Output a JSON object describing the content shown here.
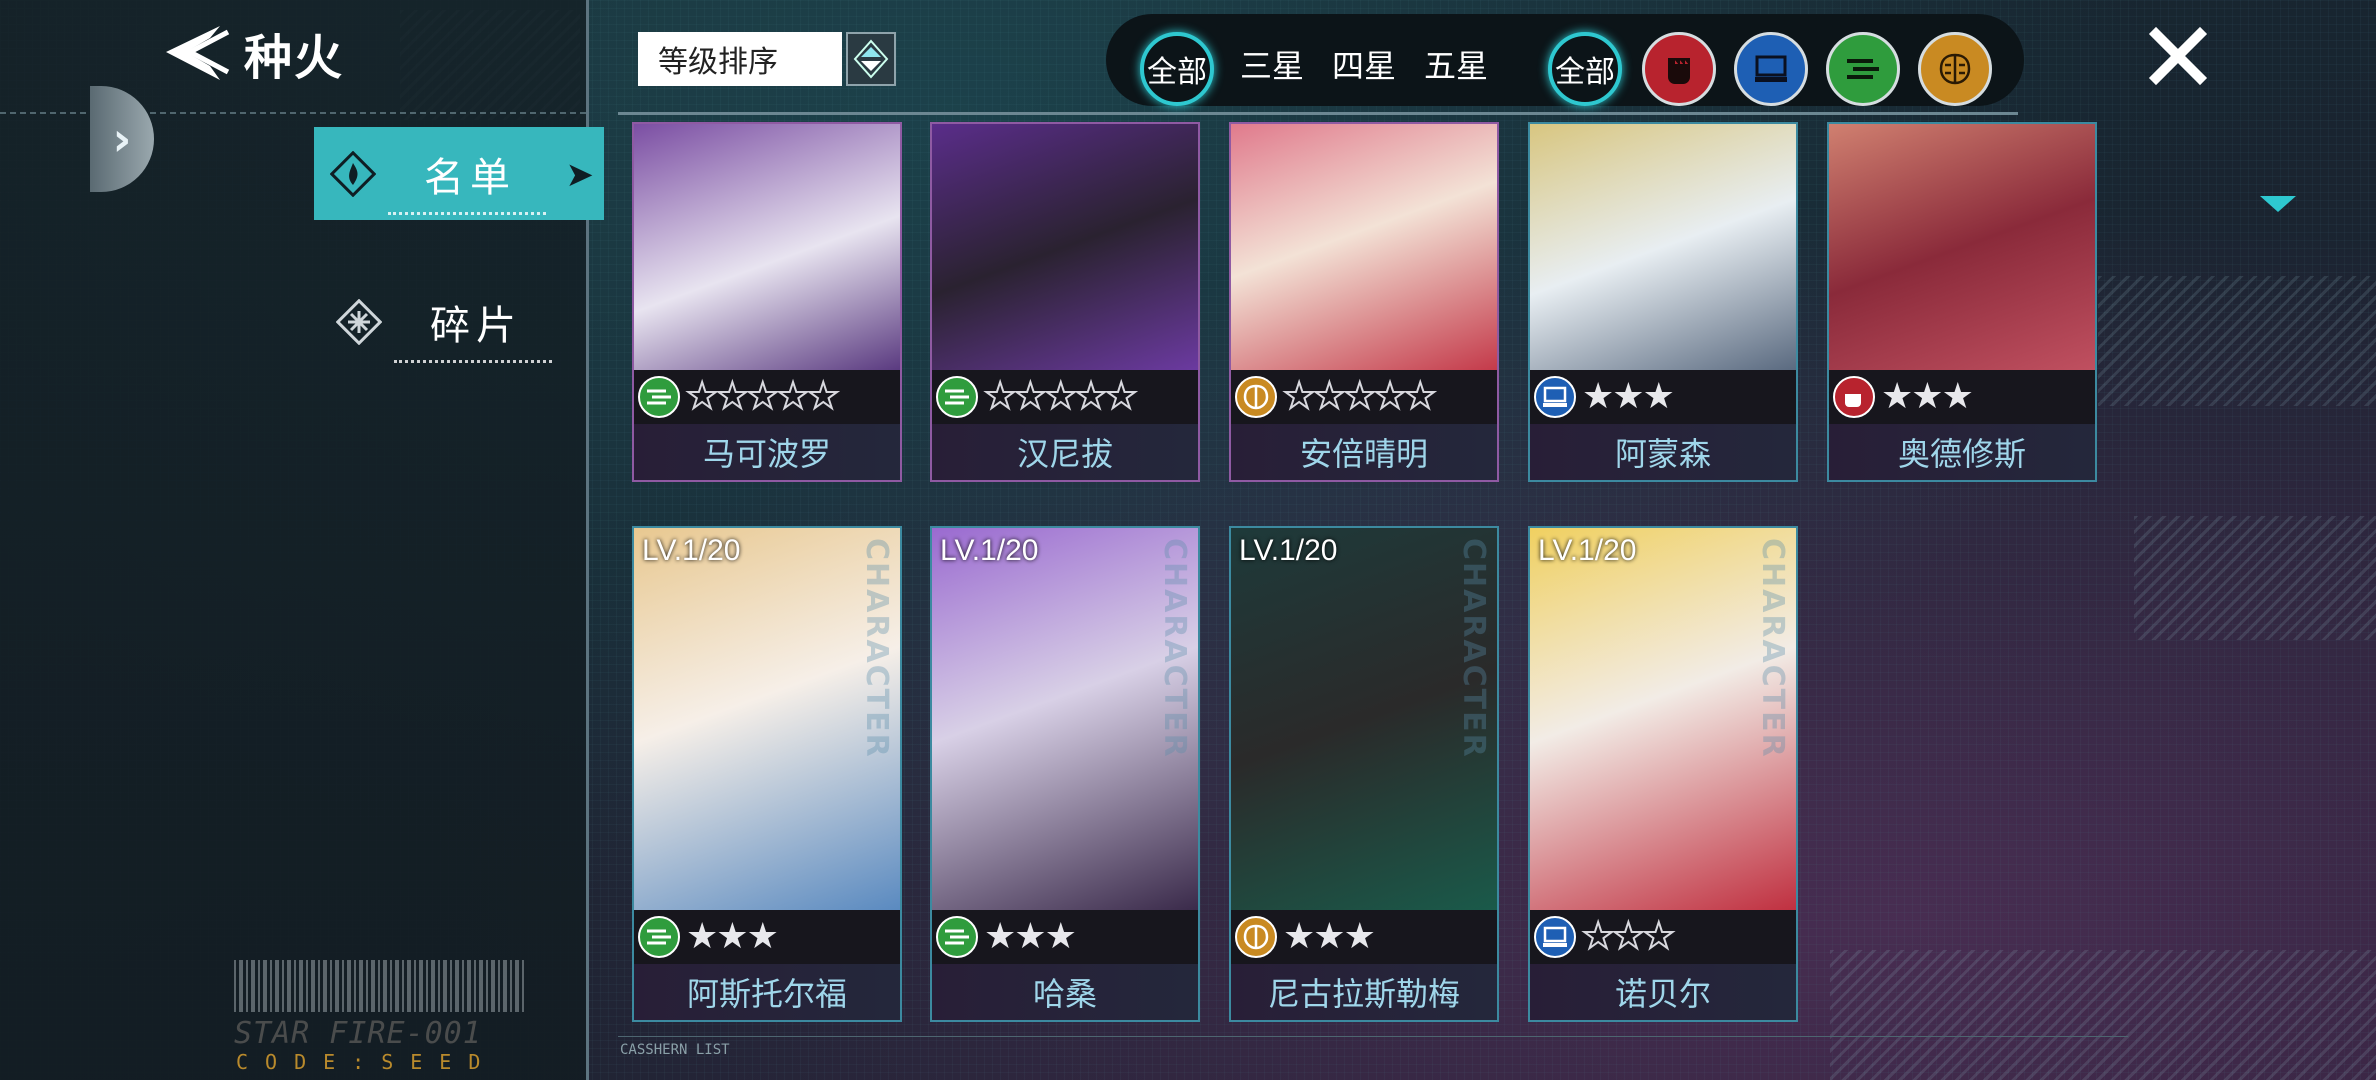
{
  "header": {
    "title": "种火"
  },
  "sidebar": {
    "items": [
      {
        "label": "名单",
        "active": true
      },
      {
        "label": "碎片",
        "active": false
      }
    ],
    "brand": {
      "barcode_text": "STAR FIRE-001",
      "code": "CODE:SEED"
    }
  },
  "sort": {
    "label": "等级排序"
  },
  "filters": {
    "rarity": [
      "全部",
      "三星",
      "四星",
      "五星"
    ],
    "type_all": "全部",
    "type_icons": [
      "fist-icon",
      "computer-icon",
      "wave-icon",
      "brain-icon"
    ]
  },
  "colors": {
    "accent": "#37b7bd",
    "fist": "#b8232e",
    "computer": "#1e5fb4",
    "wave": "#2f9c3d",
    "brain": "#c98a22"
  },
  "cards": [
    {
      "name": "马可波罗",
      "attr": "wave",
      "stars": 5,
      "filled": 0,
      "level": ""
    },
    {
      "name": "汉尼拔",
      "attr": "wave",
      "stars": 5,
      "filled": 0,
      "level": ""
    },
    {
      "name": "安倍晴明",
      "attr": "brain",
      "stars": 5,
      "filled": 0,
      "level": ""
    },
    {
      "name": "阿蒙森",
      "attr": "computer",
      "stars": 3,
      "filled": 3,
      "level": ""
    },
    {
      "name": "奥德修斯",
      "attr": "fist",
      "stars": 3,
      "filled": 3,
      "level": ""
    },
    {
      "name": "阿斯托尔福",
      "attr": "wave",
      "stars": 3,
      "filled": 3,
      "level": "LV.1/20"
    },
    {
      "name": "哈桑",
      "attr": "wave",
      "stars": 3,
      "filled": 3,
      "level": "LV.1/20"
    },
    {
      "name": "尼古拉斯勒梅",
      "attr": "brain",
      "stars": 3,
      "filled": 3,
      "level": "LV.1/20"
    },
    {
      "name": "诺贝尔",
      "attr": "computer",
      "stars": 3,
      "filled": 0,
      "level": "LV.1/20"
    }
  ],
  "card_watermark": "CHARACTER",
  "footer": {
    "label": "CASSHERN LIST"
  }
}
